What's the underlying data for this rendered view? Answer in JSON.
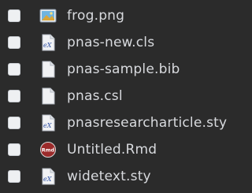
{
  "files": [
    {
      "name": "frog.png",
      "icon": "image-file-icon"
    },
    {
      "name": "pnas-new.cls",
      "icon": "tex-file-icon"
    },
    {
      "name": "pnas-sample.bib",
      "icon": "text-file-icon"
    },
    {
      "name": "pnas.csl",
      "icon": "text-file-icon"
    },
    {
      "name": "pnasresearcharticle.sty",
      "icon": "tex-file-icon"
    },
    {
      "name": "Untitled.Rmd",
      "icon": "rmd-file-icon",
      "icon_label": "Rmd"
    },
    {
      "name": "widetext.sty",
      "icon": "tex-file-icon"
    }
  ],
  "colors": {
    "background": "#2b2b2b",
    "text": "#d8dade",
    "checkbox": "#eef0f2",
    "tex_icon_accent": "#2e4fa3",
    "rmd_icon_accent": "#9b2b2b"
  }
}
